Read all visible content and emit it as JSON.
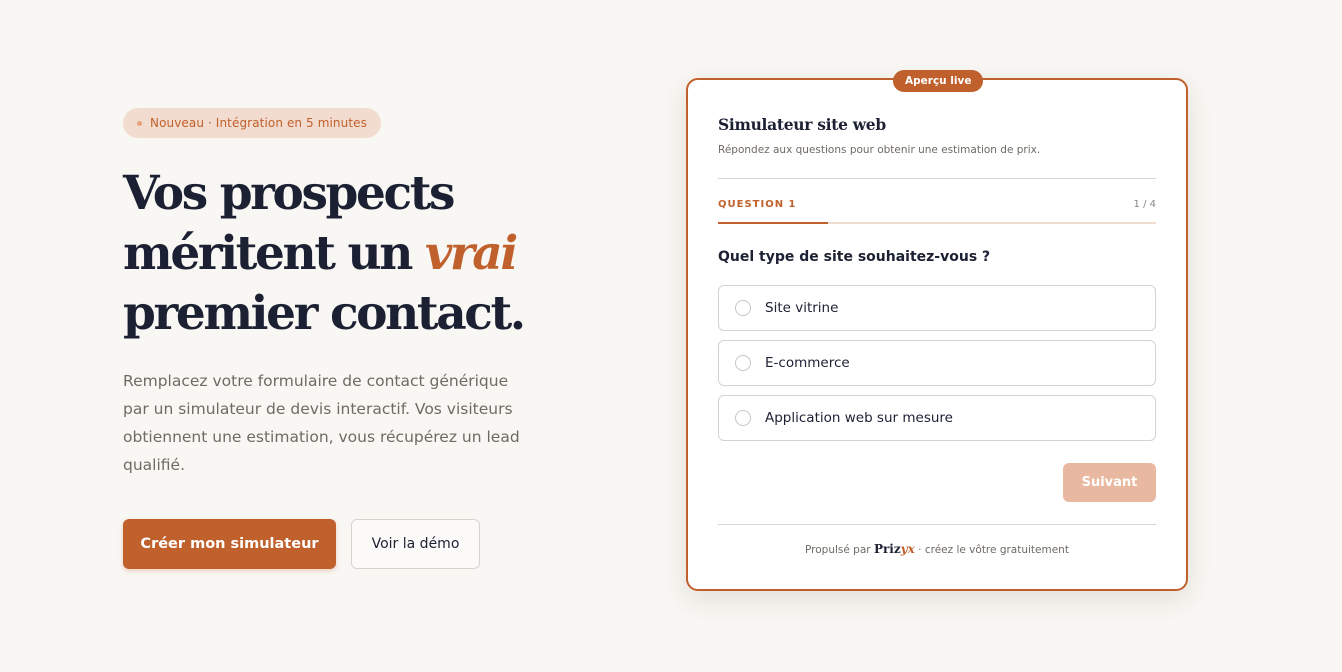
{
  "hero": {
    "badge": "Nouveau · Intégration en 5 minutes",
    "headline_line1": "Vos prospects",
    "headline_line2_prefix": "méritent un ",
    "headline_accent": "vrai",
    "headline_line3": "premier contact.",
    "lead": "Remplacez votre formulaire de contact générique par un simulateur de devis interactif. Vos visiteurs obtiennent une estimation, vous récupérez un lead qualifié.",
    "primary_cta": "Créer mon simulateur",
    "secondary_cta": "Voir la démo"
  },
  "card": {
    "live_badge": "Aperçu live",
    "title": "Simulateur site web",
    "subtitle": "Répondez aux questions pour obtenir une estimation de prix.",
    "question_label": "QUESTION 1",
    "question_count": "1 / 4",
    "progress": 0.25,
    "question": "Quel type de site souhaitez-vous ?",
    "options": [
      {
        "label": "Site vitrine",
        "selected": false
      },
      {
        "label": "E-commerce",
        "selected": false
      },
      {
        "label": "Application web sur mesure",
        "selected": false
      }
    ],
    "next_button": "Suivant",
    "footer_prefix": "Propulsé par",
    "brand_main": "Priz",
    "brand_accent": "yx",
    "footer_suffix": "· créez le vôtre gratuitement"
  },
  "colors": {
    "accent": "#c0602c",
    "background": "#f9f7f3",
    "text": "#1c2033",
    "disabled_button": "#e8b9a0"
  }
}
